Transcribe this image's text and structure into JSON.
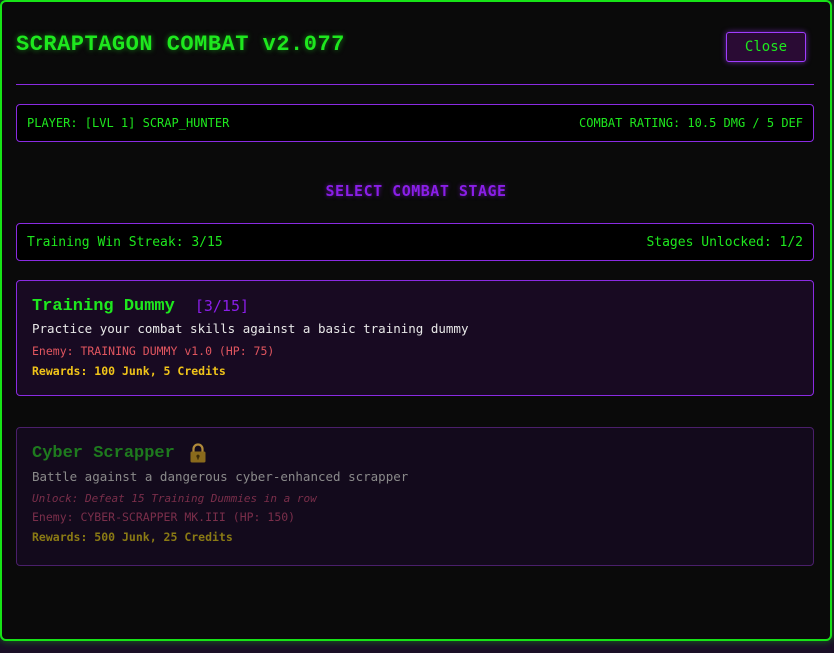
{
  "header": {
    "title": "SCRAPTAGON COMBAT v2.077",
    "close_label": "Close"
  },
  "player_bar": {
    "player": "PLAYER: [LVL 1] SCRAP_HUNTER",
    "rating": "COMBAT RATING: 10.5 DMG / 5 DEF"
  },
  "stage_heading": "SELECT COMBAT STAGE",
  "streak_bar": {
    "streak": "Training Win Streak: 3/15",
    "unlocked": "Stages Unlocked: 1/2"
  },
  "stages": [
    {
      "name": "Training Dummy",
      "progress": "[3/15]",
      "description": "Practice your combat skills against a basic training dummy",
      "enemy": "Enemy: TRAINING DUMMY v1.0 (HP: 75)",
      "rewards": "Rewards: 100 Junk, 5 Credits",
      "locked": false
    },
    {
      "name": "Cyber Scrapper",
      "description": "Battle against a dangerous cyber-enhanced scrapper",
      "unlock": "Unlock: Defeat 15 Training Dummies in a row",
      "enemy": "Enemy: CYBER-SCRAPPER MK.III (HP: 150)",
      "rewards": "Rewards: 500 Junk, 25 Credits",
      "locked": true,
      "icon": "lock-icon"
    }
  ],
  "colors": {
    "accent_green": "#1ee81e",
    "accent_purple": "#8a2be2",
    "reward_gold": "#f0c419",
    "enemy_red": "#e0555f"
  }
}
